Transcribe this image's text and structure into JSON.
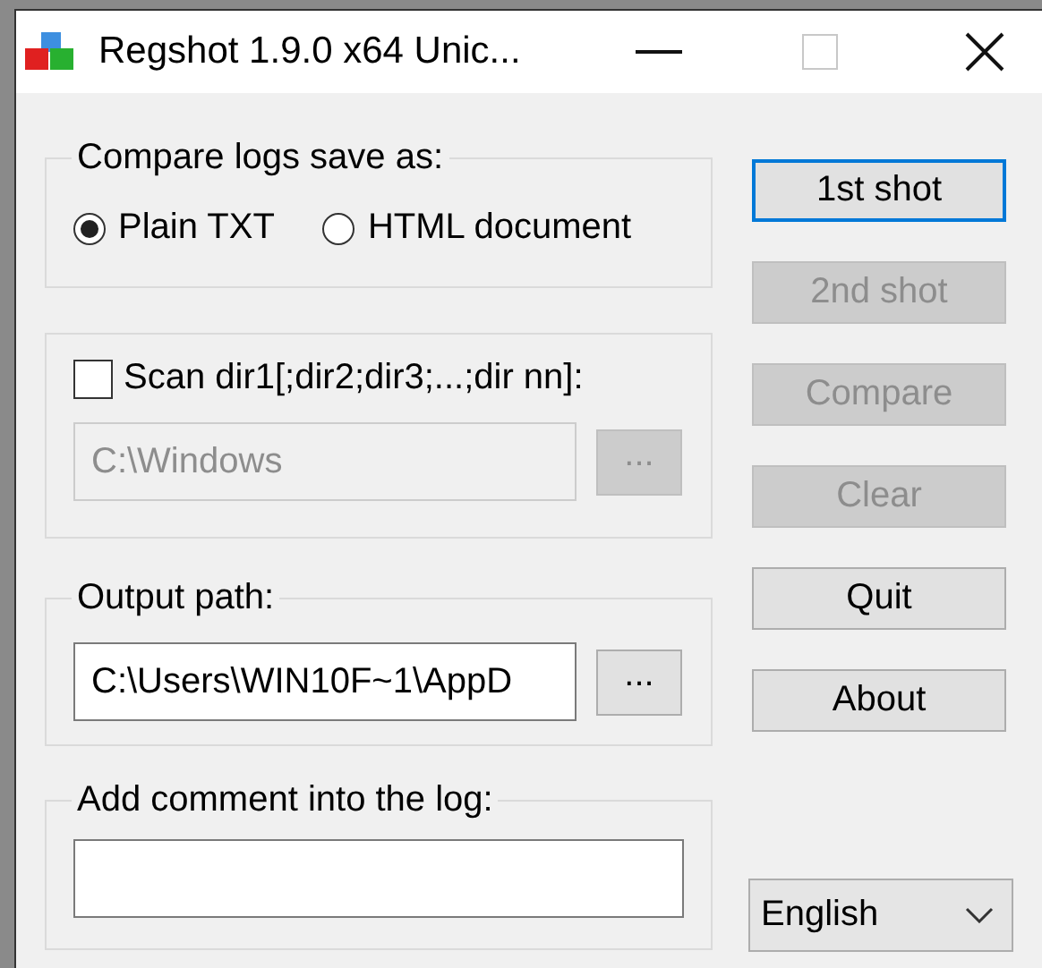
{
  "window": {
    "title": "Regshot 1.9.0 x64 Unic..."
  },
  "compare_logs": {
    "legend": "Compare logs save as:",
    "options": [
      {
        "label": "Plain TXT",
        "selected": true
      },
      {
        "label": "HTML document",
        "selected": false
      }
    ]
  },
  "scan_dirs": {
    "checkbox": {
      "label": "Scan dir1[;dir2;dir3;...;dir nn]:",
      "checked": false
    },
    "field": {
      "value": "C:\\Windows",
      "disabled": true
    },
    "browse": {
      "label": "...",
      "disabled": true
    }
  },
  "output_path": {
    "legend": "Output path:",
    "field": {
      "value": "C:\\Users\\WIN10F~1\\AppD",
      "disabled": false
    },
    "browse": {
      "label": "...",
      "disabled": false
    }
  },
  "comment": {
    "legend": "Add comment into the log:"
  },
  "buttons": [
    {
      "label": "1st shot",
      "disabled": false,
      "focused": true
    },
    {
      "label": "2nd shot",
      "disabled": true,
      "focused": false
    },
    {
      "label": "Compare",
      "disabled": true,
      "focused": false
    },
    {
      "label": "Clear",
      "disabled": true,
      "focused": false
    },
    {
      "label": "Quit",
      "disabled": false,
      "focused": false
    },
    {
      "label": "About",
      "disabled": false,
      "focused": false
    }
  ],
  "language": {
    "value": "English"
  }
}
